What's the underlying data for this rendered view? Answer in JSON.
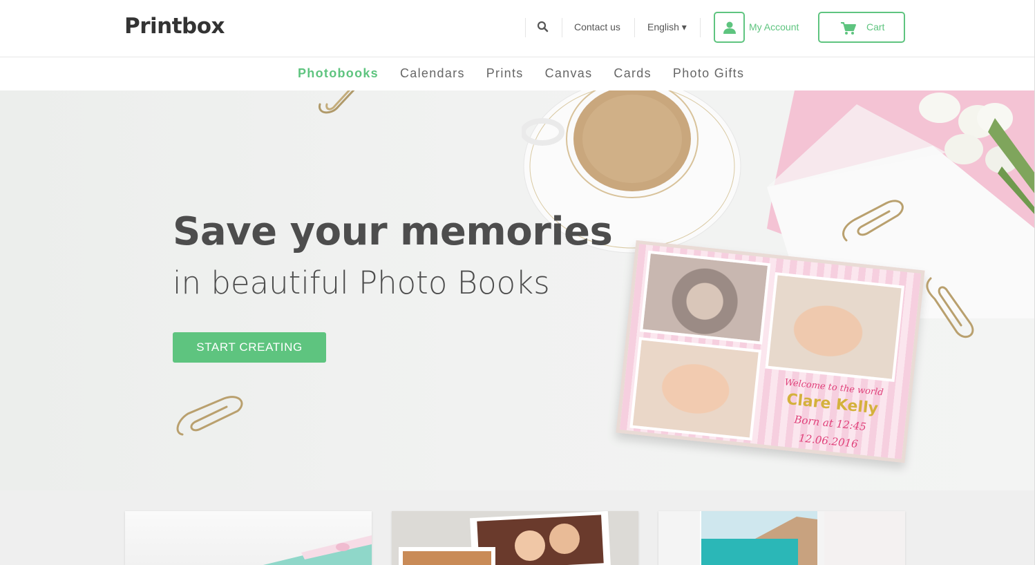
{
  "header": {
    "logo": "Printbox",
    "contact": "Contact us",
    "language": "English ▾",
    "account": "My Account",
    "cart": "Cart",
    "icons": {
      "search": "search-icon",
      "account": "user-icon",
      "cart": "cart-icon"
    }
  },
  "nav": {
    "items": [
      "Photobooks",
      "Calendars",
      "Prints",
      "Canvas",
      "Cards",
      "Photo Gifts"
    ],
    "active": "Photobooks"
  },
  "hero": {
    "title": "Save your memories",
    "subtitle": "in beautiful Photo Books",
    "cta": "START CREATING",
    "card": {
      "welcome": "Welcome to the world",
      "name": "Clare Kelly",
      "born": "Born at 12:45",
      "date": "12.06.2016"
    }
  },
  "colors": {
    "accent": "#5ec47f",
    "text": "#4d4d4d"
  }
}
